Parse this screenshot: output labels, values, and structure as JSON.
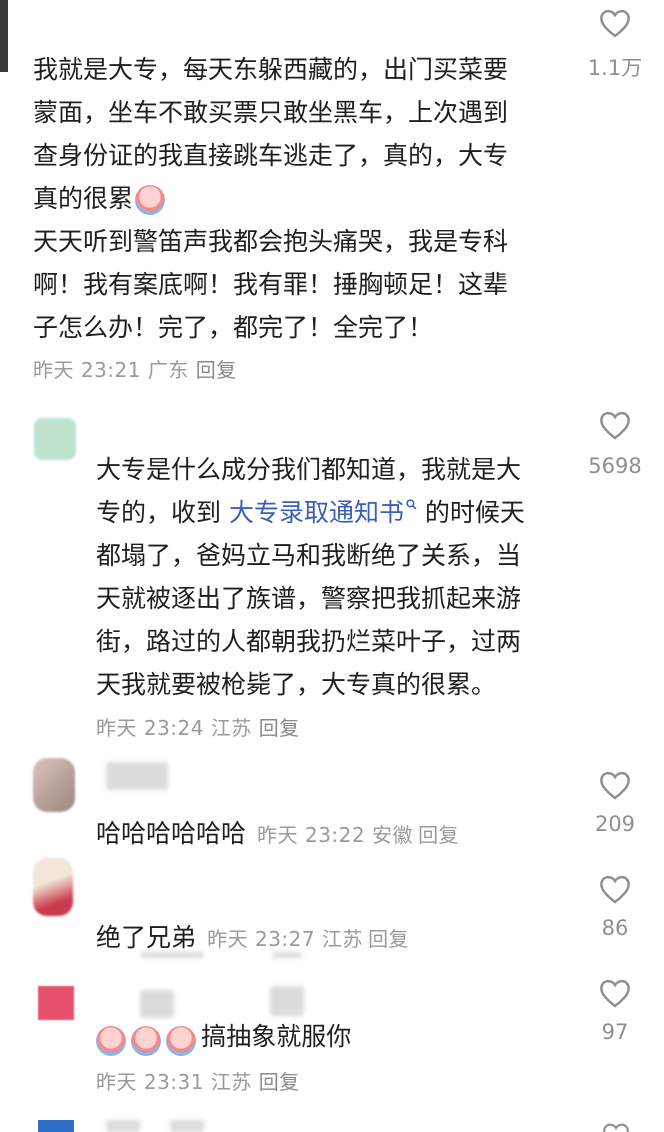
{
  "comments": [
    {
      "text_lines": [
        "我就是大专，每天东躲西藏的，出门买菜要",
        "蒙面，坐车不敢买票只敢坐黑车，上次遇到",
        "查身份证的我直接跳车逃走了，真的，大专",
        "真的很累",
        "天天听到警笛声我都会抱头痛哭，我是专科",
        "啊！我有案底啊！我有罪！捶胸顿足！这辈",
        "子怎么办！完了，都完了！全完了！"
      ],
      "meta": "昨天 23:21 广东",
      "reply": "回复",
      "likes": "1.1万"
    },
    {
      "line1": "大专是什么成分我们都知道，我就是大",
      "line2_pre": "专的，收到 ",
      "line2_link": "大专录取通知书",
      "line2_post": " 的时候天",
      "rest_lines": [
        "都塌了，爸妈立马和我断绝了关系，当",
        "天就被逐出了族谱，警察把我抓起来游",
        "街，路过的人都朝我扔烂菜叶子，过两",
        "天我就要被枪毙了，大专真的很累。"
      ],
      "meta": "昨天 23:24 江苏",
      "reply": "回复",
      "likes": "5698"
    },
    {
      "text": "哈哈哈哈哈哈",
      "meta": "昨天 23:22 安徽",
      "reply": "回复",
      "likes": "209"
    },
    {
      "text": "绝了兄弟",
      "meta": "昨天 23:27 江苏",
      "reply": "回复",
      "likes": "86"
    },
    {
      "text": "搞抽象就服你",
      "meta": "昨天 23:31 江苏",
      "reply": "回复",
      "likes": "97"
    }
  ],
  "icons": {
    "like": "heart-outline-icon",
    "emoji": "crying-face-emoji-icon",
    "link": "search-link-icon"
  },
  "colors": {
    "link": "#3b5fb5",
    "meta": "#9a9a9a"
  }
}
